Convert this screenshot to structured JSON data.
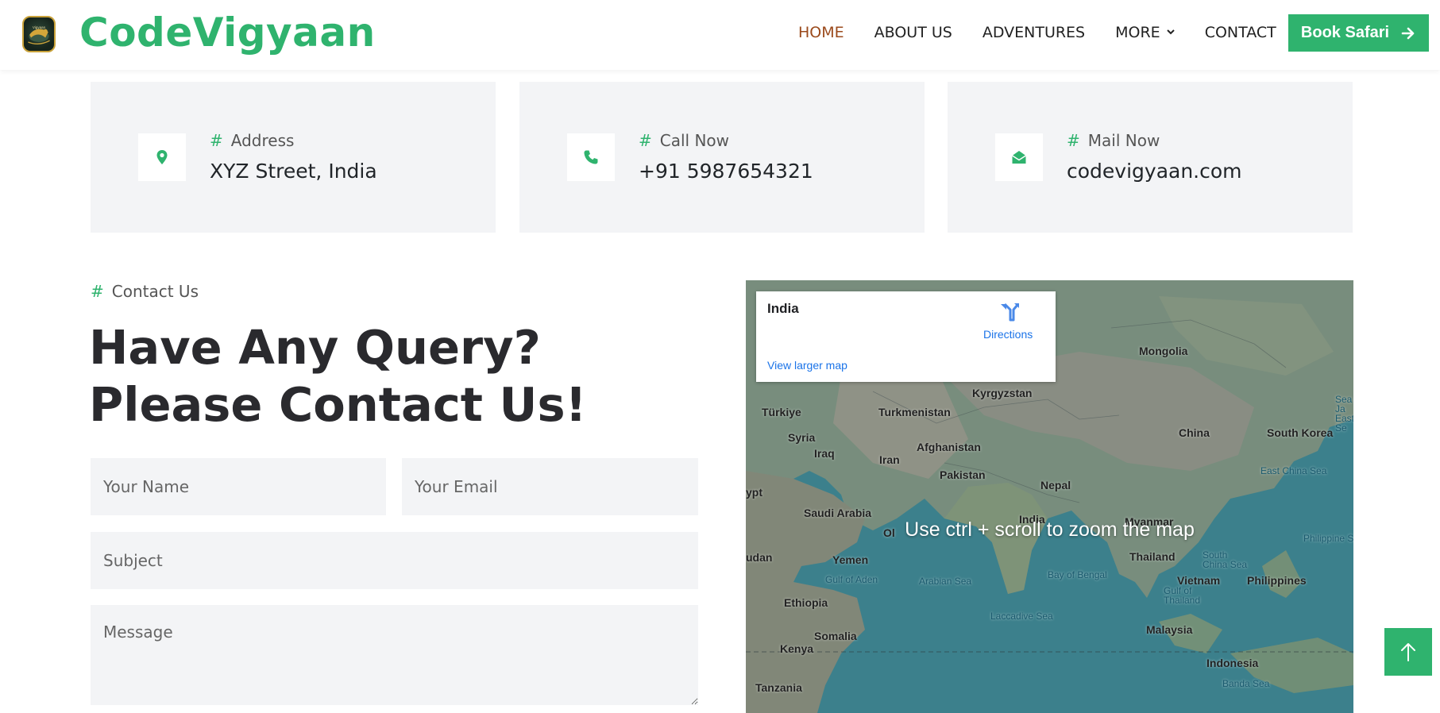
{
  "header": {
    "brand": "CodeVigyaan",
    "logo_icon": "leopard-logo",
    "nav": [
      "HOME",
      "ABOUT US",
      "ADVENTURES",
      "MORE",
      "CONTACT"
    ],
    "active_nav": "HOME",
    "book_button": "Book Safari",
    "colors": {
      "brand": "#2fb36e",
      "active": "#9b4a1c"
    }
  },
  "info_cards": [
    {
      "icon": "location-pin-icon",
      "label": "Address",
      "value": "XYZ Street, India"
    },
    {
      "icon": "phone-icon",
      "label": "Call Now",
      "value": "+91 5987654321"
    },
    {
      "icon": "envelope-open-icon",
      "label": "Mail Now",
      "value": "codevigyaan.com"
    }
  ],
  "contact": {
    "tag": "Contact Us",
    "heading": "Have Any Query? Please Contact Us!",
    "form": {
      "name_placeholder": "Your Name",
      "email_placeholder": "Your Email",
      "subject_placeholder": "Subject",
      "message_placeholder": "Message"
    }
  },
  "map": {
    "place": "India",
    "directions": "Directions",
    "larger_map": "View larger map",
    "hint": "Use ctrl + scroll to zoom the map",
    "labels": {
      "mongolia": "Mongolia",
      "kyrgyzstan": "Kyrgyzstan",
      "turkiye": "Türkiye",
      "turkmenistan": "Turkmenistan",
      "syria": "Syria",
      "iraq": "Iraq",
      "iran": "Iran",
      "afghanistan": "Afghanistan",
      "china": "China",
      "south_korea": "South Korea",
      "sea_of_japan": "Sea of Ja East Se",
      "east_china_sea": "East China Sea",
      "pakistan": "Pakistan",
      "nepal": "Nepal",
      "egypt": "ypt",
      "saudi_arabia": "Saudi Arabia",
      "oman": "Ol",
      "india": "India",
      "myanmar": "Myanmar",
      "philippine_sea": "Philippine Se",
      "sudan": "udan",
      "yemen": "Yemen",
      "thailand": "Thailand",
      "south_china_sea": "South China Sea",
      "gulf_of_aden": "Gulf of Aden",
      "arabian_sea": "Arabian Sea",
      "bay_of_bengal": "Bay of Bengal",
      "vietnam": "Vietnam",
      "philippines": "Philippines",
      "gulf_of_thailand": "Gulf of Thailand",
      "ethiopia": "Ethiopia",
      "laccadive_sea": "Laccadive Sea",
      "somalia": "Somalia",
      "malaysia": "Malaysia",
      "kenya": "Kenya",
      "indonesia": "Indonesia",
      "tanzania": "Tanzania",
      "banda_sea": "Banda Sea"
    }
  },
  "back_to_top_icon": "arrow-up-icon"
}
